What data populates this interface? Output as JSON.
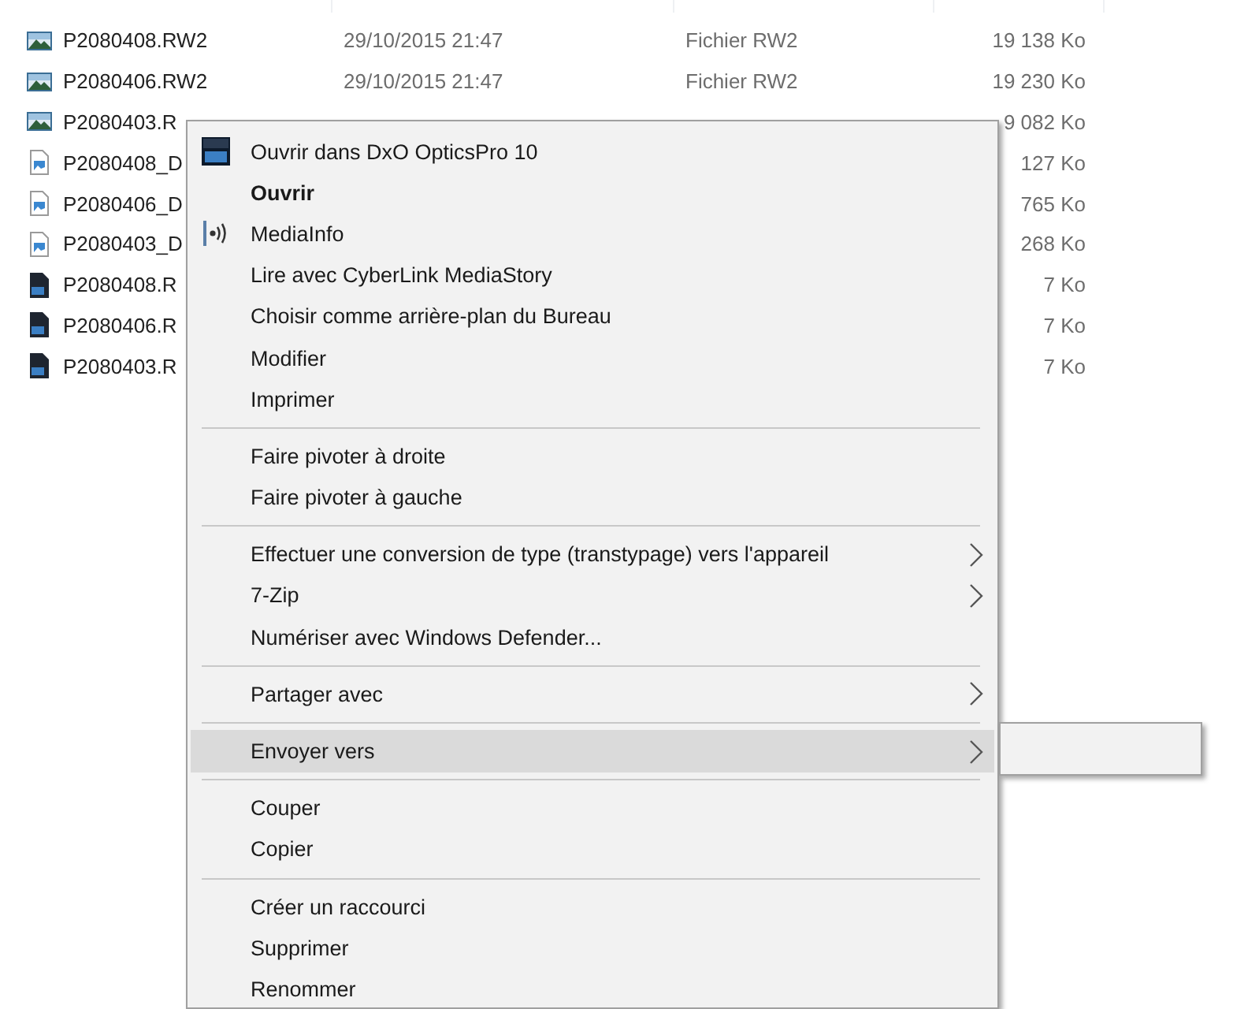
{
  "files": [
    {
      "kind": "raw",
      "name": "P2080408.RW2",
      "date": "29/10/2015 21:47",
      "type": "Fichier RW2",
      "size": "19 138 Ko"
    },
    {
      "kind": "raw",
      "name": "P2080406.RW2",
      "date": "29/10/2015 21:47",
      "type": "Fichier RW2",
      "size": "19 230 Ko"
    },
    {
      "kind": "raw",
      "name": "P2080403.R",
      "size": "9 082 Ko"
    },
    {
      "kind": "image",
      "name": "P2080408_D",
      "size": "127 Ko"
    },
    {
      "kind": "image",
      "name": "P2080406_D",
      "size": "765 Ko"
    },
    {
      "kind": "image",
      "name": "P2080403_D",
      "size": "268 Ko"
    },
    {
      "kind": "dxo",
      "name": "P2080408.R",
      "size": "7 Ko"
    },
    {
      "kind": "dxo",
      "name": "P2080406.R",
      "size": "7 Ko"
    },
    {
      "kind": "dxo",
      "name": "P2080403.R",
      "size": "7 Ko"
    }
  ],
  "context_menu": {
    "items": [
      {
        "kind": "app-item",
        "label": "Ouvrir dans DxO OpticsPro 10",
        "default": false,
        "submenu": false,
        "selected": false
      },
      {
        "kind": "item",
        "label": "Ouvrir",
        "default": true,
        "submenu": false,
        "selected": false
      },
      {
        "kind": "media-item",
        "label": "MediaInfo",
        "default": false,
        "submenu": false,
        "selected": false
      },
      {
        "kind": "item",
        "label": "Lire avec CyberLink MediaStory",
        "default": false,
        "submenu": false,
        "selected": false
      },
      {
        "kind": "item",
        "label": "Choisir comme arrière-plan du Bureau",
        "default": false,
        "submenu": false,
        "selected": false
      },
      {
        "kind": "item",
        "label": "Modifier",
        "default": false,
        "submenu": false,
        "selected": false
      },
      {
        "kind": "item",
        "label": "Imprimer",
        "default": false,
        "submenu": false,
        "selected": false
      },
      {
        "kind": "separator"
      },
      {
        "kind": "item",
        "label": "Faire pivoter à droite",
        "default": false,
        "submenu": false,
        "selected": false
      },
      {
        "kind": "item",
        "label": "Faire pivoter à gauche",
        "default": false,
        "submenu": false,
        "selected": false
      },
      {
        "kind": "separator"
      },
      {
        "kind": "item",
        "label": "Effectuer une conversion de type (transtypage) vers l'appareil",
        "default": false,
        "submenu": true,
        "selected": false
      },
      {
        "kind": "item",
        "label": "7-Zip",
        "default": false,
        "submenu": true,
        "selected": false
      },
      {
        "kind": "item",
        "label": "Numériser avec Windows Defender...",
        "default": false,
        "submenu": false,
        "selected": false
      },
      {
        "kind": "separator"
      },
      {
        "kind": "item",
        "label": "Partager avec",
        "default": false,
        "submenu": true,
        "selected": false
      },
      {
        "kind": "separator"
      },
      {
        "kind": "item",
        "label": "Envoyer vers",
        "default": false,
        "submenu": true,
        "selected": true,
        "expanded": true
      },
      {
        "kind": "separator"
      },
      {
        "kind": "item",
        "label": "Couper",
        "default": false,
        "submenu": false,
        "selected": false
      },
      {
        "kind": "item",
        "label": "Copier",
        "default": false,
        "submenu": false,
        "selected": false
      },
      {
        "kind": "separator"
      },
      {
        "kind": "item",
        "label": "Créer un raccourci",
        "default": false,
        "submenu": false,
        "selected": false
      },
      {
        "kind": "item",
        "label": "Supprimer",
        "default": false,
        "submenu": false,
        "selected": false
      },
      {
        "kind": "item",
        "label": "Renommer",
        "default": false,
        "submenu": false,
        "selected": false
      }
    ]
  }
}
